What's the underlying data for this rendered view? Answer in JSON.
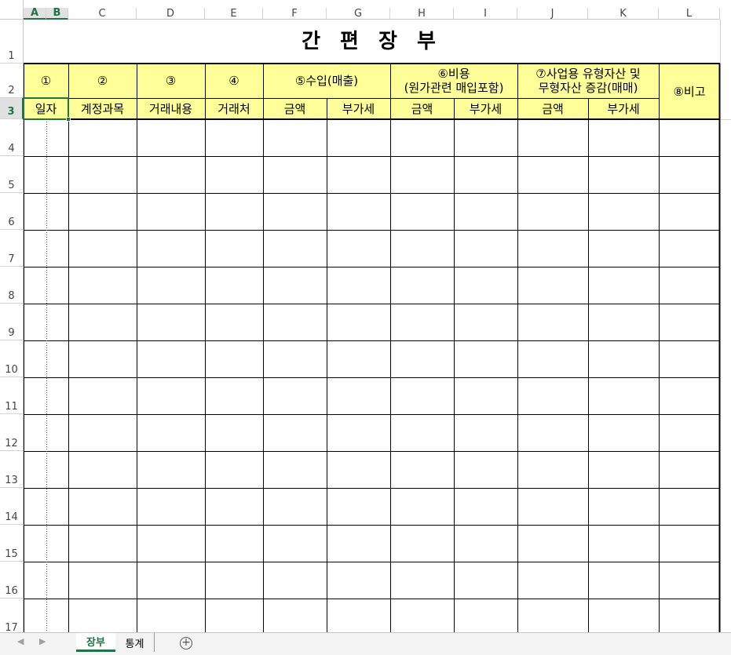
{
  "columns": [
    "A",
    "B",
    "C",
    "D",
    "E",
    "F",
    "G",
    "H",
    "I",
    "J",
    "K",
    "L"
  ],
  "rows": [
    "1",
    "2",
    "3",
    "4",
    "5",
    "6",
    "7",
    "8",
    "9",
    "10",
    "11",
    "12",
    "13",
    "14",
    "15",
    "16",
    "17"
  ],
  "selected_cell": {
    "col": "A:B",
    "row": "3"
  },
  "title": "간 편 장 부",
  "headers": {
    "h1": "①",
    "h2": "②",
    "h3": "③",
    "h4": "④",
    "h5": "⑤수입(매출)",
    "h6_line1": "⑥비용",
    "h6_line2": "(원가관련 매입포함)",
    "h7_line1": "⑦사업용 유형자산 및",
    "h7_line2": "무형자산 증감(매매)",
    "h8": "⑧비고",
    "date": "일자",
    "account": "계정과목",
    "description": "거래내용",
    "counterparty": "거래처",
    "amount": "금액",
    "vat": "부가세"
  },
  "tabs": {
    "active": "장부",
    "second": "통계",
    "add_icon": "+"
  },
  "colors": {
    "header_fill": "#ffff99",
    "excel_green": "#217346"
  }
}
